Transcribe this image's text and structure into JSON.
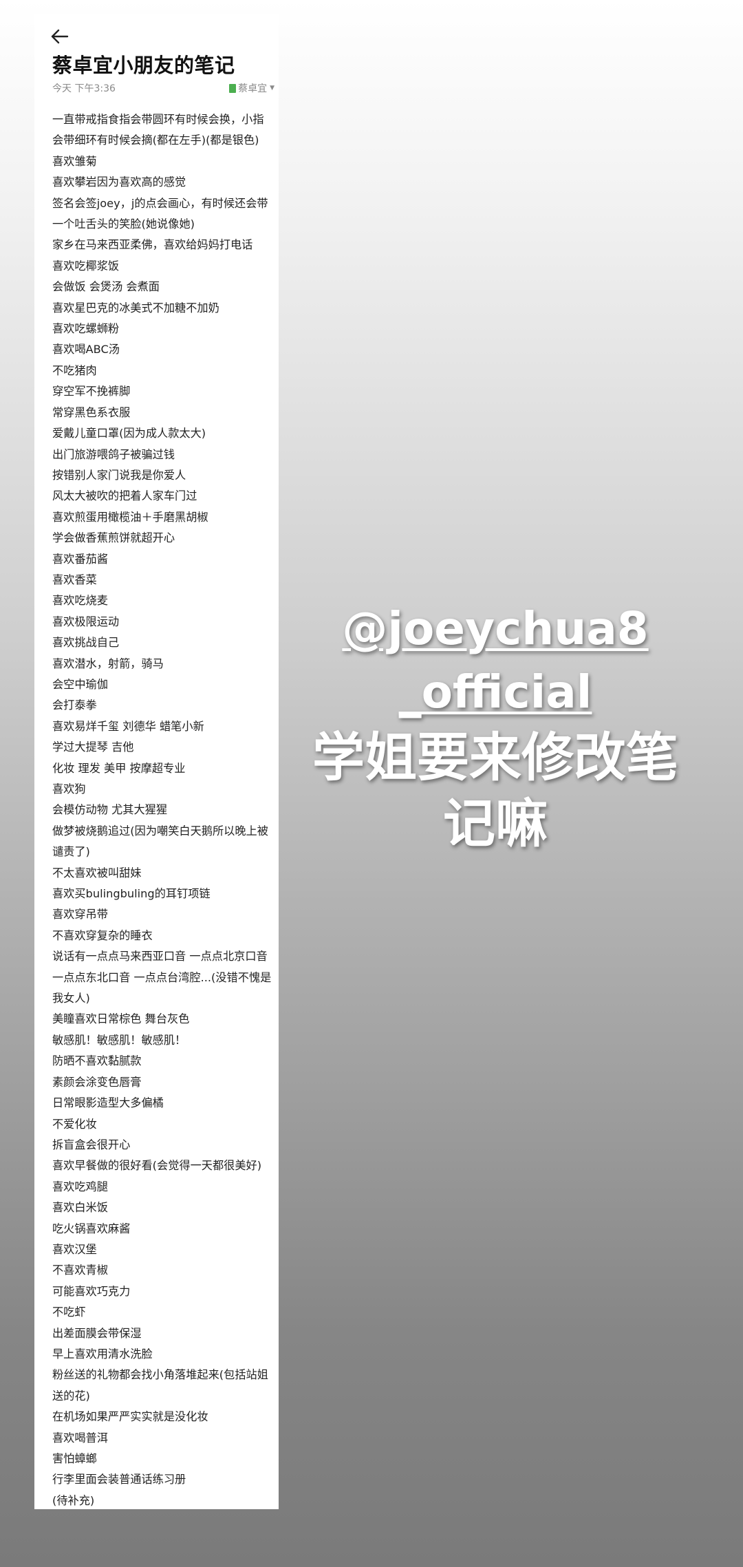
{
  "note": {
    "title": "蔡卓宜小朋友的笔记",
    "timestamp": "今天 下午3:36",
    "notebook": "蔡卓宜",
    "back_icon": "arrow-left-icon",
    "notebook_icon_color": "#4caf50",
    "lines": [
      "一直带戒指食指会带圆环有时候会换，小指",
      "会带细环有时候会摘(都在左手)(都是银色)",
      "喜欢雏菊",
      "喜欢攀岩因为喜欢高的感觉",
      "签名会签joey，j的点会画心，有时候还会带",
      "一个吐舌头的笑脸(她说像她)",
      "家乡在马来西亚柔佛，喜欢给妈妈打电话",
      "喜欢吃椰浆饭",
      "会做饭 会煲汤 会煮面",
      "喜欢星巴克的冰美式不加糖不加奶",
      "喜欢吃螺蛳粉",
      "喜欢喝ABC汤",
      "不吃猪肉",
      "穿空军不挽裤脚",
      "常穿黑色系衣服",
      "爱戴儿童口罩(因为成人款太大)",
      "出门旅游喂鸽子被骗过钱",
      "按错别人家门说我是你爱人",
      "风太大被吹的把着人家车门过",
      "喜欢煎蛋用橄榄油＋手磨黑胡椒",
      "学会做香蕉煎饼就超开心",
      "喜欢番茄酱",
      "喜欢香菜",
      "喜欢吃烧麦",
      "喜欢极限运动",
      "喜欢挑战自己",
      "喜欢潜水，射箭，骑马",
      "会空中瑜伽",
      "会打泰拳",
      "喜欢易烊千玺 刘德华 蜡笔小新",
      "学过大提琴 吉他",
      "化妆 理发 美甲 按摩超专业",
      "喜欢狗",
      "会模仿动物 尤其大猩猩",
      "做梦被烧鹅追过(因为嘲笑白天鹅所以晚上被",
      "谴责了)",
      "不太喜欢被叫甜妹",
      "喜欢买bulingbuling的耳钉项链",
      "喜欢穿吊带",
      "不喜欢穿复杂的睡衣",
      "说话有一点点马来西亚口音 一点点北京口音",
      "一点点东北口音 一点点台湾腔...(没错不愧是",
      "我女人)",
      "美瞳喜欢日常棕色 舞台灰色",
      "敏感肌！敏感肌！敏感肌！",
      "防晒不喜欢黏腻款",
      "素颜会涂变色唇膏",
      "日常眼影造型大多偏橘",
      "不爱化妆",
      "拆盲盒会很开心",
      "喜欢早餐做的很好看(会觉得一天都很美好)",
      "喜欢吃鸡腿",
      "喜欢白米饭",
      "吃火锅喜欢麻酱",
      "喜欢汉堡",
      "不喜欢青椒",
      "可能喜欢巧克力",
      "不吃虾",
      "出差面膜会带保湿",
      "早上喜欢用清水洗脸",
      "粉丝送的礼物都会找小角落堆起来(包括站姐",
      "送的花)",
      "在机场如果严严实实就是没化妆",
      "喜欢喝普洱",
      "害怕蟑螂",
      "行李里面会装普通话练习册",
      "(待补充)"
    ]
  },
  "watermark": {
    "handle_line1": "@joeychua8",
    "handle_line2": "_official",
    "caption_line1": "学姐要来修改笔",
    "caption_line2": "记嘛"
  }
}
